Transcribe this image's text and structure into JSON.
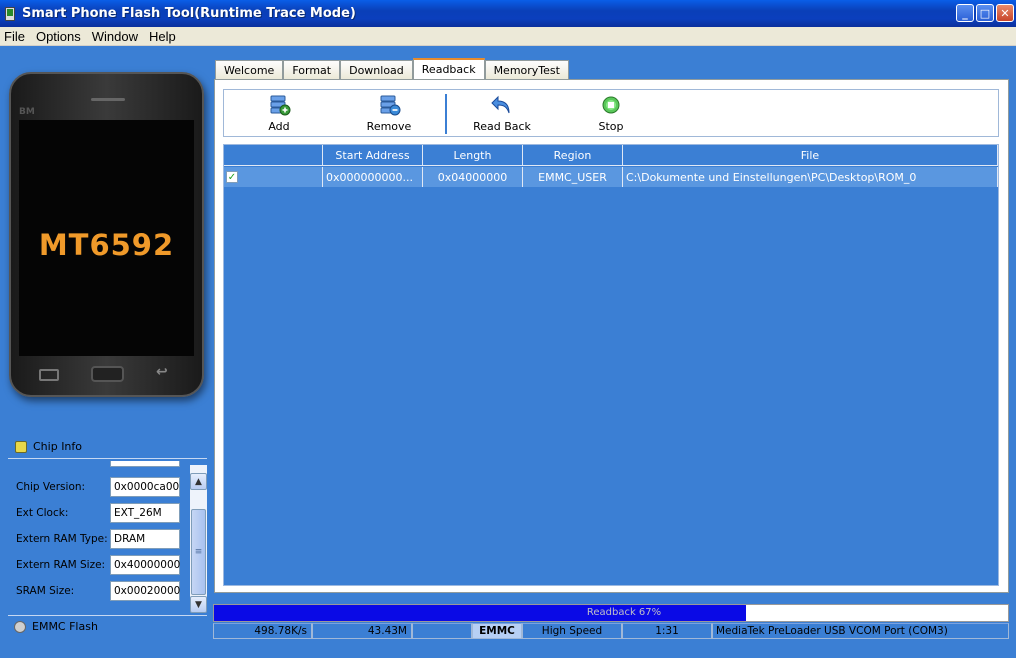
{
  "window": {
    "title": "Smart Phone Flash Tool(Runtime Trace Mode)"
  },
  "menu": [
    "File",
    "Options",
    "Window",
    "Help"
  ],
  "phone": {
    "brand": "BM",
    "model": "MT6592"
  },
  "chip_info": {
    "header": "Chip Info",
    "rows": [
      {
        "label": "Chip Version:",
        "value": "0x0000ca00"
      },
      {
        "label": "Ext Clock:",
        "value": "EXT_26M"
      },
      {
        "label": "Extern RAM Type:",
        "value": "DRAM"
      },
      {
        "label": "Extern RAM Size:",
        "value": "0x40000000"
      },
      {
        "label": "SRAM Size:",
        "value": "0x00020000"
      }
    ],
    "footer": "EMMC Flash"
  },
  "tabs": [
    "Welcome",
    "Format",
    "Download",
    "Readback",
    "MemoryTest"
  ],
  "active_tab": "Readback",
  "toolbar": {
    "add": "Add",
    "remove": "Remove",
    "read_back": "Read Back",
    "stop": "Stop"
  },
  "table": {
    "headers": [
      "",
      "Start Address",
      "Length",
      "Region",
      "File"
    ],
    "rows": [
      {
        "checked": true,
        "start_address": "0x000000000...",
        "length": "0x04000000",
        "region": "EMMC_USER",
        "file": "C:\\Dokumente und Einstellungen\\PC\\Desktop\\ROM_0"
      }
    ]
  },
  "progress": {
    "label": "Readback 67%",
    "fraction": 0.67
  },
  "statusbar": {
    "speed": "498.78K/s",
    "size": "43.43M",
    "blank": "",
    "storage": "EMMC",
    "mode": "High Speed",
    "time": "1:31",
    "port": "MediaTek PreLoader USB VCOM Port (COM3)"
  },
  "colors": {
    "background": "#3b7fd4",
    "progress_fill": "#0a0ae6",
    "titlebar": "#0b3fbd"
  }
}
